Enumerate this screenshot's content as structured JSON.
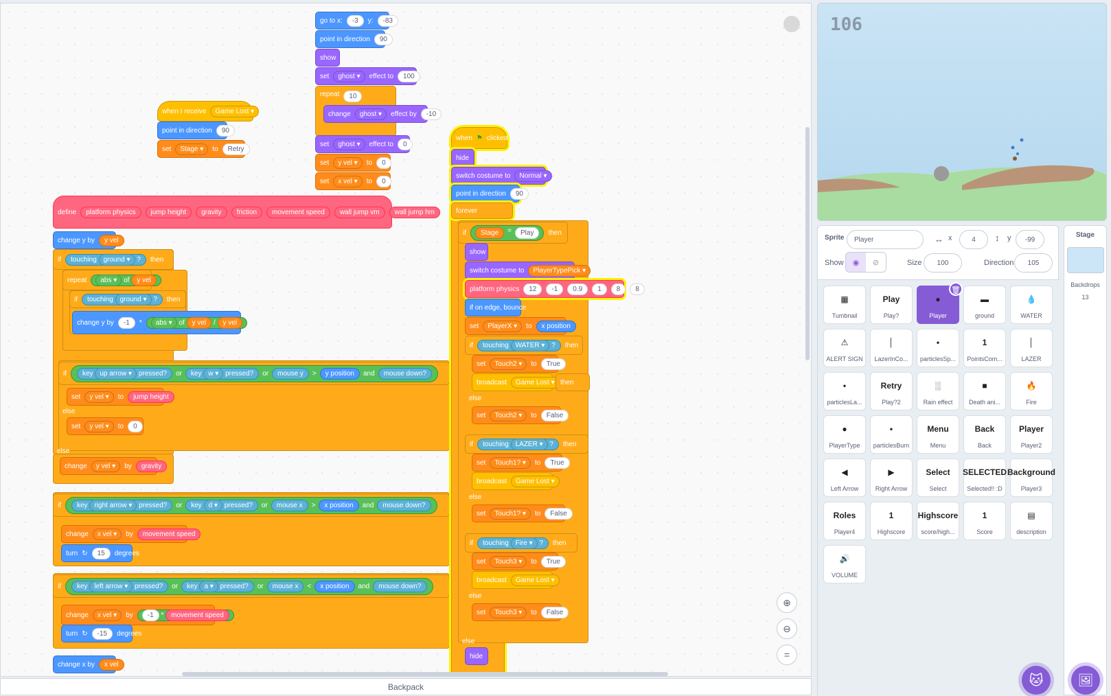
{
  "colors": {
    "motion": "#4c97ff",
    "looks": "#9966ff",
    "events": "#ffbf00",
    "control": "#ffab19",
    "variables": "#ff8c1a",
    "myblocks": "#ff6680",
    "sensing": "#5cb1d6",
    "operators": "#59c059",
    "accent": "#855cd6"
  },
  "script_a": {
    "goto": [
      "go to x:",
      "-3",
      "y:",
      "-83"
    ],
    "dir": [
      "point in direction",
      "90"
    ],
    "show": "show",
    "setghost": [
      "set",
      "ghost",
      "effect to",
      "100"
    ],
    "repeat": [
      "repeat",
      "10"
    ],
    "changeghost": [
      "change",
      "ghost",
      "effect by",
      "-10"
    ],
    "setghost0": [
      "set",
      "ghost",
      "effect to",
      "0"
    ],
    "setyvel": [
      "set",
      "y vel",
      "to",
      "0"
    ],
    "setxvel": [
      "set",
      "x vel",
      "to",
      "0"
    ]
  },
  "script_b": {
    "hat": [
      "when I receive",
      "Game Lost"
    ],
    "dir": [
      "point in direction",
      "90"
    ],
    "set": [
      "set",
      "Stage",
      "to",
      "Retry"
    ]
  },
  "script_c": {
    "define": [
      "define",
      "platform physics",
      "jump height",
      "gravity",
      "friction",
      "movement speed",
      "wall jump vm",
      "wall jump hm"
    ],
    "changey": [
      "change y by",
      "y vel"
    ],
    "if1": [
      "if",
      "touching",
      "ground",
      "?",
      "then"
    ],
    "repeat": [
      "repeat",
      "abs",
      "of",
      "y vel"
    ],
    "if2": [
      "if",
      "touching",
      "ground",
      "?",
      "then"
    ],
    "changey2": [
      "change y by",
      "-1",
      "*",
      "abs",
      "of",
      "y vel",
      "/",
      "y vel"
    ],
    "if3": [
      "if",
      "key",
      "up arrow",
      "pressed?",
      "or",
      "key",
      "w",
      "pressed?",
      "or",
      "mouse y",
      ">",
      "y position",
      "and",
      "mouse down?"
    ],
    "setjump": [
      "set",
      "y vel",
      "to",
      "jump height"
    ],
    "else1": "else",
    "sety0": [
      "set",
      "y vel",
      "to",
      "0"
    ],
    "else2": "else",
    "changegrav": [
      "change",
      "y vel",
      "by",
      "gravity"
    ],
    "if4": [
      "if",
      "key",
      "right arrow",
      "pressed?",
      "or",
      "key",
      "d",
      "pressed?",
      "or",
      "mouse x",
      ">",
      "x position",
      "and",
      "mouse down?"
    ],
    "changexv": [
      "change",
      "x vel",
      "by",
      "movement speed"
    ],
    "turn1": [
      "turn",
      "15",
      "degrees"
    ],
    "if5": [
      "if",
      "key",
      "left arrow",
      "pressed?",
      "or",
      "key",
      "a",
      "pressed?",
      "or",
      "mouse x",
      "<",
      "x position",
      "and",
      "mouse down?"
    ],
    "changexv2": [
      "change",
      "x vel",
      "by",
      "-1",
      "*",
      "movement speed"
    ],
    "turn2": [
      "turn",
      "-15",
      "degrees"
    ],
    "changex": [
      "change x by",
      "x vel"
    ]
  },
  "script_d": {
    "hat": [
      "when",
      "clicked"
    ],
    "hide": "hide",
    "costume": [
      "switch costume to",
      "Normal"
    ],
    "dir": [
      "point in direction",
      "90"
    ],
    "forever": "forever",
    "if1": [
      "if",
      "Stage",
      "=",
      "Play",
      "then"
    ],
    "show": "show",
    "costume2": [
      "switch costume to",
      "PlayerTypePick"
    ],
    "phys": [
      "platform physics",
      "12",
      "-1",
      "0.9",
      "1",
      "8",
      "8"
    ],
    "edge": "if on edge, bounce",
    "setpx": [
      "set",
      "PlayerX",
      "to",
      "x position"
    ],
    "ifw": [
      "if",
      "touching",
      "WATER",
      "?",
      "then"
    ],
    "t2": [
      "set",
      "Touch2",
      "to",
      "True"
    ],
    "bc1": [
      "broadcast",
      "Game Lost"
    ],
    "then2": "then",
    "else1": "else",
    "t2f": [
      "set",
      "Touch2",
      "to",
      "False"
    ],
    "ifl": [
      "if",
      "touching",
      "LAZER",
      "?",
      "then"
    ],
    "t1": [
      "set",
      "Touch1?",
      "to",
      "True"
    ],
    "bc2": [
      "broadcast",
      "Game Lost"
    ],
    "else2": "else",
    "t1f": [
      "set",
      "Touch1?",
      "to",
      "False"
    ],
    "iff": [
      "if",
      "touching",
      "Fire",
      "?",
      "then"
    ],
    "t3": [
      "set",
      "Touch3",
      "to",
      "True"
    ],
    "bc3": [
      "broadcast",
      "Game Lost"
    ],
    "else3": "else",
    "t3f": [
      "set",
      "Touch3",
      "to",
      "False"
    ],
    "else4": "else",
    "hide2": "hide"
  },
  "backpack": "Backpack",
  "stage_view": {
    "score": "106"
  },
  "sprite_info": {
    "sprite_label": "Sprite",
    "sprite_name": "Player",
    "x_label": "x",
    "x": "4",
    "y_label": "y",
    "y": "-99",
    "show_label": "Show",
    "size_label": "Size",
    "size": "100",
    "direction_label": "Direction",
    "direction": "105"
  },
  "sprites": [
    {
      "name": "Tumbnail",
      "thumb": "▦"
    },
    {
      "name": "Play?",
      "thumb": "Play"
    },
    {
      "name": "Player",
      "thumb": "●"
    },
    {
      "name": "ground",
      "thumb": "▬"
    },
    {
      "name": "WATER",
      "thumb": "💧"
    },
    {
      "name": "ALERT SIGN",
      "thumb": "⚠"
    },
    {
      "name": "LazerInCo...",
      "thumb": "│"
    },
    {
      "name": "particlesSp...",
      "thumb": "•"
    },
    {
      "name": "PointsCom...",
      "thumb": "1"
    },
    {
      "name": "LAZER",
      "thumb": "│"
    },
    {
      "name": "particlesLa...",
      "thumb": "•"
    },
    {
      "name": "Play?2",
      "thumb": "Retry"
    },
    {
      "name": "Rain effect",
      "thumb": "░"
    },
    {
      "name": "Death ani...",
      "thumb": "■"
    },
    {
      "name": "Fire",
      "thumb": "🔥"
    },
    {
      "name": "PlayerType",
      "thumb": "●"
    },
    {
      "name": "particlesBurn",
      "thumb": "•"
    },
    {
      "name": "Menu",
      "thumb": "Menu"
    },
    {
      "name": "Back",
      "thumb": "Back"
    },
    {
      "name": "Player2",
      "thumb": "Player"
    },
    {
      "name": "Left Arrow",
      "thumb": "◀"
    },
    {
      "name": "Right Arrow",
      "thumb": "▶"
    },
    {
      "name": "Select",
      "thumb": "Select"
    },
    {
      "name": "Selected!! :D",
      "thumb": "SELECTED"
    },
    {
      "name": "Player3",
      "thumb": "Background"
    },
    {
      "name": "Player4",
      "thumb": "Roles"
    },
    {
      "name": "Highscore",
      "thumb": "1"
    },
    {
      "name": "score/high...",
      "thumb": "Highscore"
    },
    {
      "name": "Score",
      "thumb": "1"
    },
    {
      "name": "description",
      "thumb": "▤"
    },
    {
      "name": "VOLUME",
      "thumb": "🔊"
    }
  ],
  "stage_pane": {
    "title": "Stage",
    "backdrops_label": "Backdrops",
    "backdrops_count": "13"
  }
}
